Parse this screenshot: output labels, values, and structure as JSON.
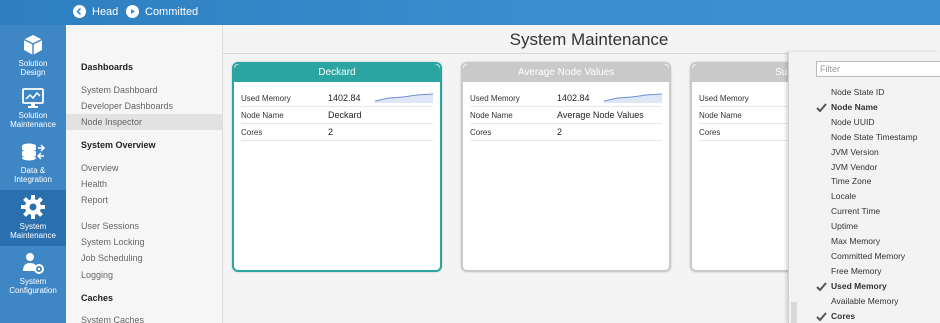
{
  "topbar": {
    "head_label": "Head",
    "committed_label": "Committed"
  },
  "rail": {
    "items": [
      {
        "label1": "Solution",
        "label2": "Design",
        "icon": "cube-icon"
      },
      {
        "label1": "Solution",
        "label2": "Maintenance",
        "icon": "monitor-chart-icon"
      },
      {
        "label1": "Data &",
        "label2": "Integration",
        "icon": "database-arrows-icon"
      },
      {
        "label1": "System",
        "label2": "Maintenance",
        "icon": "gear-icon",
        "active": true
      },
      {
        "label1": "System",
        "label2": "Configuration",
        "icon": "user-gear-icon"
      }
    ]
  },
  "subnav": {
    "dashboards_header": "Dashboards",
    "dashboards": [
      "System Dashboard",
      "Developer Dashboards",
      "Node Inspector"
    ],
    "overview_header": "System Overview",
    "overview": [
      "Overview",
      "Health",
      "Report"
    ],
    "other": [
      "User Sessions",
      "System Locking",
      "Job Scheduling",
      "Logging"
    ],
    "caches_header": "Caches",
    "caches": [
      "System Caches"
    ]
  },
  "main": {
    "title": "System Maintenance"
  },
  "cards": [
    {
      "title": "Deckard",
      "used_memory_label": "Used Memory",
      "used_memory": "1402.84",
      "node_name_label": "Node Name",
      "node_name": "Deckard",
      "cores_label": "Cores",
      "cores": "2"
    },
    {
      "title": "Average Node Values",
      "used_memory_label": "Used Memory",
      "used_memory": "1402.84",
      "node_name_label": "Node Name",
      "node_name": "Average Node Values",
      "cores_label": "Cores",
      "cores": "2"
    },
    {
      "title": "Sum of a",
      "used_memory_label": "Used Memory",
      "used_memory": "",
      "node_name_label": "Node Name",
      "node_name": "",
      "cores_label": "Cores",
      "cores": ""
    }
  ],
  "column_picker": {
    "filter_placeholder": "Filter",
    "options": [
      {
        "label": "Node State ID",
        "checked": false
      },
      {
        "label": "Node Name",
        "checked": true
      },
      {
        "label": "Node UUID",
        "checked": false
      },
      {
        "label": "Node State Timestamp",
        "checked": false
      },
      {
        "label": "JVM Version",
        "checked": false
      },
      {
        "label": "JVM Vendor",
        "checked": false
      },
      {
        "label": "Time Zone",
        "checked": false
      },
      {
        "label": "Locale",
        "checked": false
      },
      {
        "label": "Current Time",
        "checked": false
      },
      {
        "label": "Uptime",
        "checked": false
      },
      {
        "label": "Max Memory",
        "checked": false
      },
      {
        "label": "Committed Memory",
        "checked": false
      },
      {
        "label": "Free Memory",
        "checked": false
      },
      {
        "label": "Used Memory",
        "checked": true
      },
      {
        "label": "Available Memory",
        "checked": false
      },
      {
        "label": "Cores",
        "checked": true
      }
    ]
  },
  "colors": {
    "accent": "#3f86c5",
    "teal": "#2aa5a2",
    "grey_card": "#c9c9c9"
  }
}
